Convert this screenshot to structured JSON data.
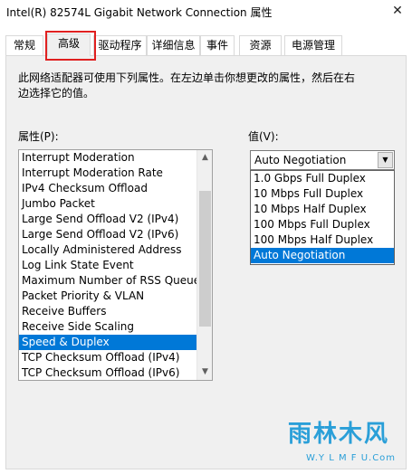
{
  "window": {
    "title": "Intel(R) 82574L Gigabit Network Connection 属性",
    "close_glyph": "✕"
  },
  "tabs": [
    {
      "label": "常规"
    },
    {
      "label": "高级"
    },
    {
      "label": "驱动程序"
    },
    {
      "label": "详细信息"
    },
    {
      "label": "事件"
    },
    {
      "label": "资源"
    },
    {
      "label": "电源管理"
    }
  ],
  "active_tab": "高级",
  "description": "此网络适配器可使用下列属性。在左边单击你想更改的属性，然后在右边选择它的值。",
  "property": {
    "label": "属性(P):",
    "items": [
      "Interrupt Moderation",
      "Interrupt Moderation Rate",
      "IPv4 Checksum Offload",
      "Jumbo Packet",
      "Large Send Offload V2 (IPv4)",
      "Large Send Offload V2 (IPv6)",
      "Locally Administered Address",
      "Log Link State Event",
      "Maximum Number of RSS Queue",
      "Packet Priority & VLAN",
      "Receive Buffers",
      "Receive Side Scaling",
      "Speed & Duplex",
      "TCP Checksum Offload (IPv4)",
      "TCP Checksum Offload (IPv6)"
    ],
    "selected": "Speed & Duplex"
  },
  "value": {
    "label": "值(V):",
    "current": "Auto Negotiation",
    "options": [
      "1.0 Gbps Full Duplex",
      "10 Mbps Full Duplex",
      "10 Mbps Half Duplex",
      "100 Mbps Full Duplex",
      "100 Mbps Half Duplex",
      "Auto Negotiation"
    ],
    "highlighted": "Auto Negotiation"
  },
  "watermark": {
    "logo": "雨林木风",
    "url": "W.Y L M F U.Com"
  },
  "colors": {
    "selection": "#0078d7",
    "highlight_box": "#e02020",
    "watermark": "#2a9fd8"
  }
}
